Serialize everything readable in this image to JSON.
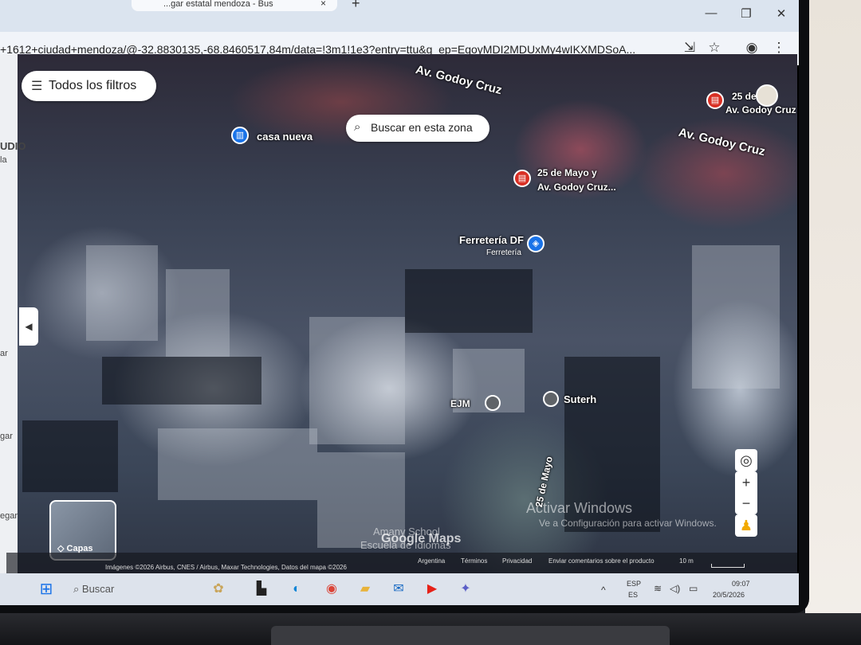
{
  "browser": {
    "tab_title": "...gar estatal mendoza - Bus",
    "tab_close": "×",
    "new_tab": "+",
    "url": "+1612+ciudad+mendoza/@-32.8830135,-68.8460517,84m/data=!3m1!1e3?entry=ttu&g_ep=EgoyMDI2MDUxMy4wIKXMDSoA...",
    "window_controls": [
      "—",
      "❐",
      "✕"
    ]
  },
  "left_panel": {
    "fragments": [
      "UDIO",
      "la",
      "ar",
      "gar",
      "egar"
    ],
    "collapse_glyph": "◀"
  },
  "map": {
    "filters_button": "Todos los filtros",
    "search_this_area": "Buscar en esta zona",
    "streets": [
      {
        "name": "Av. Godoy Cruz"
      },
      {
        "name": "Av. Godoy Cruz"
      },
      {
        "name": "25 de Mayo"
      }
    ],
    "pois": [
      {
        "name": "casa nueva",
        "icon": "museum-icon",
        "color": "#1a73e8"
      },
      {
        "name": "25 de Mayo y",
        "name2": "Av. Godoy Cruz...",
        "icon": "bus-stop-icon",
        "color": "#d93025"
      },
      {
        "name": "25 de y",
        "name2": "Av. Godoy Cruz",
        "icon": "bus-stop-icon",
        "color": "#d93025"
      },
      {
        "name": "Ferretería DF",
        "subtitle": "Ferretería",
        "icon": "shopping-bag-icon",
        "color": "#1a73e8"
      },
      {
        "name": "EJM",
        "icon": "place-icon",
        "color": "#5f6368"
      },
      {
        "name": "Suterh",
        "icon": "place-icon",
        "color": "#5f6368"
      }
    ],
    "layers_label": "Capas",
    "watermarks": [
      "Amany School",
      "Escuela de Idiomas",
      "Google Maps",
      "Activar Windows",
      "Ve a Configuración para activar Windows."
    ],
    "zoom_in": "+",
    "zoom_out": "−",
    "attribution": {
      "imagery": "Imágenes ©2026 Airbus, CNES / Airbus, Maxar Technologies, Datos del mapa ©2026",
      "country": "Argentina",
      "terms": "Términos",
      "privacy": "Privacidad",
      "feedback": "Enviar comentarios sobre el producto",
      "scale": "10 m"
    }
  },
  "taskbar": {
    "search_placeholder": "Buscar",
    "lang_top": "ESP",
    "lang_bottom": "ES",
    "time": "09:07",
    "date": "20/5/2026"
  }
}
